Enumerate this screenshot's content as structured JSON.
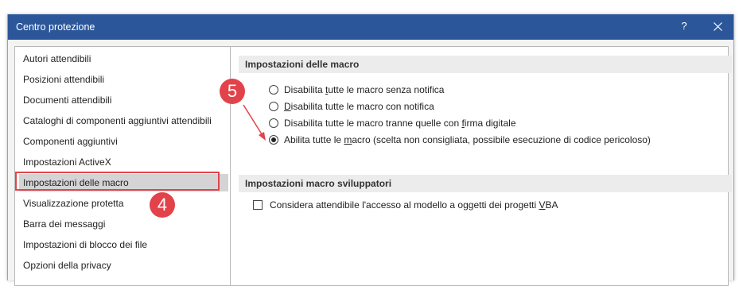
{
  "window": {
    "title": "Centro protezione",
    "help_label": "?",
    "close_icon": "close-icon"
  },
  "sidebar": {
    "items": [
      {
        "label": "Autori attendibili",
        "selected": false
      },
      {
        "label": "Posizioni attendibili",
        "selected": false
      },
      {
        "label": "Documenti attendibili",
        "selected": false
      },
      {
        "label": "Cataloghi di componenti aggiuntivi attendibili",
        "selected": false
      },
      {
        "label": "Componenti aggiuntivi",
        "selected": false
      },
      {
        "label": "Impostazioni ActiveX",
        "selected": false
      },
      {
        "label": "Impostazioni delle macro",
        "selected": true
      },
      {
        "label": "Visualizzazione protetta",
        "selected": false
      },
      {
        "label": "Barra dei messaggi",
        "selected": false
      },
      {
        "label": "Impostazioni di blocco dei file",
        "selected": false
      },
      {
        "label": "Opzioni della privacy",
        "selected": false
      }
    ]
  },
  "macro_settings": {
    "header": "Impostazioni delle macro",
    "options": [
      {
        "pre": "Disabilita ",
        "key": "t",
        "post": "utte le macro senza notifica",
        "checked": false
      },
      {
        "pre": "",
        "key": "D",
        "post": "isabilita tutte le macro con notifica",
        "checked": false
      },
      {
        "pre": "Disabilita tutte le macro tranne quelle con ",
        "key": "f",
        "post": "irma digitale",
        "checked": false
      },
      {
        "pre": "Abilita tutte le ",
        "key": "m",
        "post": "acro (scelta non consigliata, possibile esecuzione di codice pericoloso)",
        "checked": true
      }
    ]
  },
  "developer_settings": {
    "header": "Impostazioni macro sviluppatori",
    "checkbox": {
      "pre": "Considera attendibile l'accesso al modello a oggetti dei progetti ",
      "key": "V",
      "post": "BA",
      "checked": false
    }
  },
  "annotations": {
    "step4": "4",
    "step5": "5",
    "accent_color": "#e2434b"
  },
  "colors": {
    "titlebar": "#2b579a",
    "selected_item": "#d4d4d4"
  }
}
